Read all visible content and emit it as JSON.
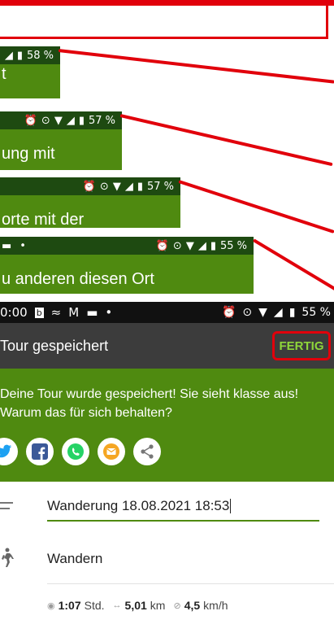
{
  "snippets": [
    {
      "status": "58 %",
      "text": "t"
    },
    {
      "status": "57 %",
      "text": "ung mit"
    },
    {
      "status": "57 %",
      "text": "orte mit der"
    },
    {
      "status": "55 %",
      "text": "u anderen diesen Ort"
    }
  ],
  "status_bar": {
    "time": "0:00",
    "battery": "55 %"
  },
  "app_bar": {
    "title": "Tour gespeichert",
    "done_label": "FERTIG"
  },
  "share_panel": {
    "message": "Deine Tour wurde gespeichert! Sie sieht klasse aus! Warum das für sich behalten?",
    "icons": [
      "twitter-icon",
      "facebook-icon",
      "whatsapp-icon",
      "email-icon",
      "share-icon"
    ]
  },
  "tour_form": {
    "name_value": "Wanderung 18.08.2021 18:53",
    "activity": "Wandern"
  },
  "stats": {
    "duration": "1:07",
    "duration_unit": "Std.",
    "distance": "5,01",
    "distance_unit": "km",
    "speed": "4,5",
    "speed_unit": "km/h"
  },
  "colors": {
    "green": "#4f8a10",
    "dark_green": "#1e4a11",
    "highlight_red": "#e1000b",
    "app_bar": "#3c3c3c",
    "accent_text": "#8fd63a"
  }
}
